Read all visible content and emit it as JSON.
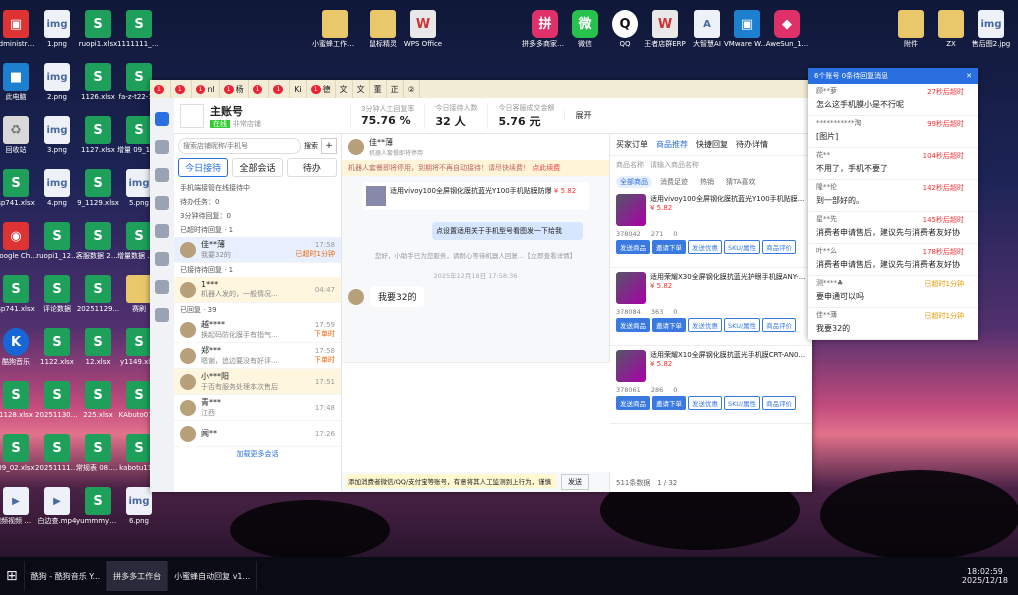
{
  "desktop": {
    "icons": [
      {
        "label": "Administra...",
        "kind": "r",
        "glyph": "▣"
      },
      {
        "label": "1.png",
        "kind": "i",
        "glyph": "img"
      },
      {
        "label": "ruopi1.xlsx",
        "kind": "s",
        "glyph": "S"
      },
      {
        "label": "1111111_1...",
        "kind": "s",
        "glyph": "S"
      },
      {
        "label": "此电脑",
        "kind": "v",
        "glyph": "■"
      },
      {
        "label": "2.png",
        "kind": "i",
        "glyph": "img"
      },
      {
        "label": "1126.xlsx",
        "kind": "s",
        "glyph": "S"
      },
      {
        "label": "fa-z-t22-1...",
        "kind": "s",
        "glyph": "S"
      },
      {
        "label": "回收站",
        "kind": "d",
        "glyph": "♻"
      },
      {
        "label": "3.png",
        "kind": "i",
        "glyph": "img"
      },
      {
        "label": "1127.xlsx",
        "kind": "s",
        "glyph": "S"
      },
      {
        "label": "增量 09_13.xlsx",
        "kind": "s",
        "glyph": "S"
      },
      {
        "label": "sp741.xlsx",
        "kind": "s",
        "glyph": "S"
      },
      {
        "label": "4.png",
        "kind": "i",
        "glyph": "img"
      },
      {
        "label": "9_1129.xlsx",
        "kind": "s",
        "glyph": "S"
      },
      {
        "label": "5.png",
        "kind": "i",
        "glyph": "img"
      },
      {
        "label": "Google Chrome",
        "kind": "r",
        "glyph": "◉"
      },
      {
        "label": "ruopi1_12...",
        "kind": "s",
        "glyph": "S"
      },
      {
        "label": "客服数据 20251130...",
        "kind": "s",
        "glyph": "S"
      },
      {
        "label": "增量数据 周11_22...",
        "kind": "s",
        "glyph": "S"
      },
      {
        "label": "sp741.xlsx",
        "kind": "s",
        "glyph": "S"
      },
      {
        "label": "评论数据",
        "kind": "s",
        "glyph": "S"
      },
      {
        "label": "20251129...",
        "kind": "s",
        "glyph": "S"
      },
      {
        "label": "赛刷",
        "kind": "f",
        "glyph": ""
      },
      {
        "label": "酷狗音乐",
        "kind": "k",
        "glyph": "K"
      },
      {
        "label": "1122.xlsx",
        "kind": "s",
        "glyph": "S"
      },
      {
        "label": "12.xlsx",
        "kind": "s",
        "glyph": "S"
      },
      {
        "label": "y1149.xlsx",
        "kind": "s",
        "glyph": "S"
      },
      {
        "label": "1128.xlsx",
        "kind": "s",
        "glyph": "S"
      },
      {
        "label": "20251130.xlsx",
        "kind": "s",
        "glyph": "S"
      },
      {
        "label": "225.xlsx",
        "kind": "s",
        "glyph": "S"
      },
      {
        "label": "KAbuto07...",
        "kind": "s",
        "glyph": "S"
      },
      {
        "label": "09_02.xlsx",
        "kind": "s",
        "glyph": "S"
      },
      {
        "label": "20251111_25...",
        "kind": "s",
        "glyph": "S"
      },
      {
        "label": "常规表 08.xlsx",
        "kind": "s",
        "glyph": "S"
      },
      {
        "label": "kabotu11...",
        "kind": "s",
        "glyph": "S"
      },
      {
        "label": "视频视频 mp4",
        "kind": "i",
        "glyph": "▶"
      },
      {
        "label": "白边查.mp4",
        "kind": "i",
        "glyph": "▶"
      },
      {
        "label": "yummmy0...",
        "kind": "s",
        "glyph": "S"
      },
      {
        "label": "6.png",
        "kind": "i",
        "glyph": "img"
      }
    ],
    "top_icons": [
      {
        "label": "小蜜蜂工作台 客服助手SP",
        "kind": "f",
        "glyph": ""
      },
      {
        "label": "鼠标精灵",
        "kind": "f",
        "glyph": ""
      },
      {
        "label": "WPS Office",
        "kind": "o",
        "glyph": "W"
      },
      {
        "label": "拼多多商家工作台",
        "kind": "p",
        "glyph": "拼"
      },
      {
        "label": "微信",
        "kind": "w",
        "glyph": "微"
      },
      {
        "label": "QQ",
        "kind": "q",
        "glyph": "Q"
      },
      {
        "label": "王者店群ERP",
        "kind": "o",
        "glyph": "W"
      },
      {
        "label": "大智慧AI",
        "kind": "i",
        "glyph": "A"
      },
      {
        "label": "VMware Workstati...",
        "kind": "v",
        "glyph": "▣"
      },
      {
        "label": "AweSun_1...",
        "kind": "p",
        "glyph": "◆"
      },
      {
        "label": "附件",
        "kind": "f",
        "glyph": ""
      },
      {
        "label": "ZX",
        "kind": "f",
        "glyph": ""
      },
      {
        "label": "售后图2.jpg",
        "kind": "i",
        "glyph": "img"
      }
    ]
  },
  "app": {
    "tabs": [
      {
        "badge": "1",
        "label": ""
      },
      {
        "badge": "1",
        "label": ""
      },
      {
        "badge": "1",
        "label": "nl"
      },
      {
        "badge": "1",
        "label": "杨"
      },
      {
        "badge": "1",
        "label": ""
      },
      {
        "badge": "1",
        "label": ""
      },
      {
        "badge": "",
        "label": "Ki"
      },
      {
        "badge": "1",
        "label": "德"
      },
      {
        "badge": "",
        "label": "文"
      },
      {
        "badge": "",
        "label": "文"
      },
      {
        "badge": "",
        "label": "董"
      },
      {
        "badge": "",
        "label": "正"
      },
      {
        "badge": "",
        "label": "②"
      }
    ],
    "shop_name": "主账号",
    "shop_status": "在线",
    "shop_sub": "非常店铺",
    "stats": [
      {
        "label": "3分钟人工回复率",
        "value": "75.76 %"
      },
      {
        "label": "今日接待人数",
        "value": "32 人"
      },
      {
        "label": "今日客服成交金额",
        "value": "5.76 元"
      }
    ],
    "expand": "展开",
    "search_placeholder": "搜索店铺昵称/手机号",
    "search_btn": "搜索",
    "tab_today": "今日接待",
    "tab_all": "全部会话",
    "tab_pending": "待办",
    "mobile_note": "手机端接管在线接待中",
    "todo": "待办任务：0",
    "wait3": "3分钟待回复：0",
    "sec_wait": "已超时待回复 · 1",
    "sec_done": "已接待待回复 · 1",
    "sec_replied": "已回复 · 39",
    "convs": [
      {
        "name": "佳**薄",
        "preview": "我要32的",
        "time": "17:58",
        "tag": "已超时1分钟"
      },
      {
        "name": "1***",
        "preview": "机器人发的，一般情况...",
        "time": "04:47",
        "tag": ""
      },
      {
        "name": "越****",
        "preview": "换起码防化膜手有指气...",
        "time": "17:59",
        "tag": "下单时"
      },
      {
        "name": "郑***",
        "preview": "嗯谢，追边要没有好评...",
        "time": "17:58",
        "tag": "下单时"
      },
      {
        "name": "小***阳",
        "preview": "于否有服务处理本次售后",
        "time": "17:51",
        "tag": ""
      },
      {
        "name": "青***",
        "preview": "江西",
        "time": "17:48",
        "tag": ""
      },
      {
        "name": "闻**",
        "preview": "",
        "time": "17:26",
        "tag": ""
      }
    ],
    "load_more": "加载更多会话",
    "chat_user": "佳**薄",
    "chat_sub": "机器人套餐即将停用",
    "notice": "机器人套餐即将停用，到期将不再自动接待！请尽快续费！",
    "notice_link": "点此续费",
    "product_msg": "适用vivoy100全屏钢化膜抗蓝光Y100手机贴膜防爆",
    "product_price": "¥ 5.82",
    "bot_msg": "点设置适用关于手机型号看图发一下给我",
    "sys_msg": "您好，小助手已为您服务，请耐心等待机器人回复...【立即查看详情】",
    "date_sep": "2025年12月18日 17:58:36",
    "cust_msg": "我要32的",
    "input_placeholder": "添加消费者微信/QQ/支付宝等账号，有意将其人工监测到上行为，谨慎",
    "send": "发送",
    "rt_tabs": [
      "买家订单",
      "商品推荐",
      "快捷回复",
      "待办详情"
    ],
    "goods_search": "商品名称",
    "goods_filter": "请输入商品名称",
    "goods_tabs": [
      "全部商品",
      "消费足迹",
      "热销",
      "猜TA喜欢"
    ],
    "goods": [
      {
        "title": "适用vivoy100全屏钢化膜抗蓝光Y100手机贴膜...",
        "price": "¥ 5.82",
        "stock": "378042",
        "sold": "271",
        "pending": "0"
      },
      {
        "title": "适用荣耀X30全屏钢化膜抗蓝光护眼手机膜ANY-...",
        "price": "¥ 5.82",
        "stock": "378084",
        "sold": "363",
        "pending": "0"
      },
      {
        "title": "适用荣耀X10全屏钢化膜抗蓝光手机膜CRT-AN0...",
        "price": "¥ 5.82",
        "stock": "378061",
        "sold": "286",
        "pending": "0"
      }
    ],
    "goods_btns": [
      "发送商品",
      "邀请下单",
      "发送优惠",
      "SKU/属性",
      "商品评价"
    ],
    "goods_total": "511条数据",
    "goods_page": "1 / 32"
  },
  "popup": {
    "title": "6个账号 0条待回复消息",
    "items": [
      {
        "user": "顾**萝",
        "tag": "27秒后超时",
        "msg": "怎么这手机膜小是不行呢"
      },
      {
        "user": "***********淘",
        "tag": "99秒后超时",
        "msg": "[图片]"
      },
      {
        "user": "花**",
        "tag": "104秒后超时",
        "msg": "不用了，手机不要了"
      },
      {
        "user": "隆**伦",
        "tag": "142秒后超时",
        "msg": "到一部好的。"
      },
      {
        "user": "星**先",
        "tag": "145秒后超时",
        "msg": "消费者申请售后，建议先与消费者友好协"
      },
      {
        "user": "叶**么",
        "tag": "178秒后超时",
        "msg": "消费者申请售后，建议先与消费者友好协"
      },
      {
        "user": "测****♣",
        "tag": "已超时1分钟",
        "msg": "要申通可以吗"
      },
      {
        "user": "佳**薄",
        "tag": "已超时1分钟",
        "msg": "我要32的"
      }
    ]
  },
  "taskbar": {
    "items": [
      "酷狗 - 酷狗音乐 Y...",
      "拼多多工作台",
      "小蜜蜂自动回复 v1..."
    ],
    "time": "18:02:59",
    "date": "2025/12/18"
  }
}
